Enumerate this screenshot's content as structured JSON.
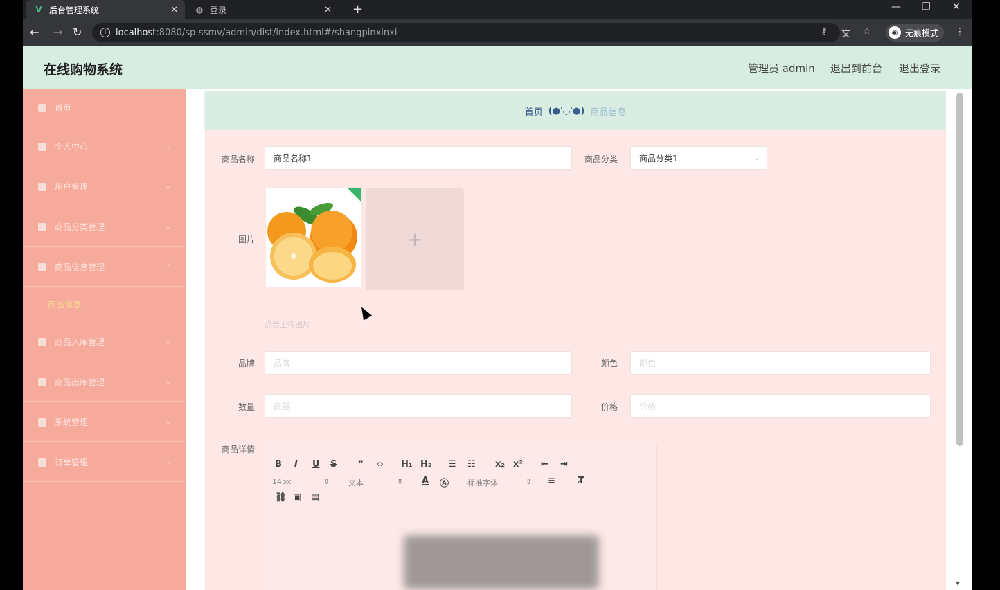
{
  "browser": {
    "tabs": [
      {
        "title": "后台管理系统",
        "active": true
      },
      {
        "title": "登录",
        "active": false
      }
    ],
    "url": {
      "host": "localhost",
      "path": ":8080/sp-ssmv/admin/dist/index.html#/shangpinxinxi"
    },
    "incognito_label": "无痕模式"
  },
  "app": {
    "title": "在线购物系统",
    "header_links": [
      "管理员 admin",
      "退出到前台",
      "退出登录"
    ]
  },
  "sidebar": {
    "items": [
      {
        "label": "首页"
      },
      {
        "label": "个人中心"
      },
      {
        "label": "用户管理"
      },
      {
        "label": "商品分类管理"
      },
      {
        "label": "商品信息管理"
      },
      {
        "label": "商品信息",
        "sub": true
      },
      {
        "label": "商品入库管理"
      },
      {
        "label": "商品出库管理"
      },
      {
        "label": "系统管理"
      },
      {
        "label": "订单管理"
      }
    ]
  },
  "breadcrumb": {
    "home": "首页",
    "separator": "(●'◡'●)",
    "current": "商品信息"
  },
  "form": {
    "name_label": "商品名称",
    "name_value": "商品名称1",
    "category_label": "商品分类",
    "category_value": "商品分类1",
    "image_label": "图片",
    "upload_tip": "点击上传图片",
    "brand_label": "品牌",
    "brand_placeholder": "品牌",
    "color_label": "颜色",
    "color_placeholder": "颜色",
    "quantity_label": "数量",
    "quantity_placeholder": "数量",
    "price_label": "价格",
    "price_placeholder": "价格",
    "detail_label": "商品详情"
  },
  "editor": {
    "font_size": "14px",
    "text_type": "文本",
    "font_family": "标准字体"
  },
  "colors": {
    "sidebar_bg": "#f5aa9c",
    "header_bg": "#d7ede2",
    "form_bg": "#fde8e6",
    "submenu_active": "#f7e08e"
  }
}
